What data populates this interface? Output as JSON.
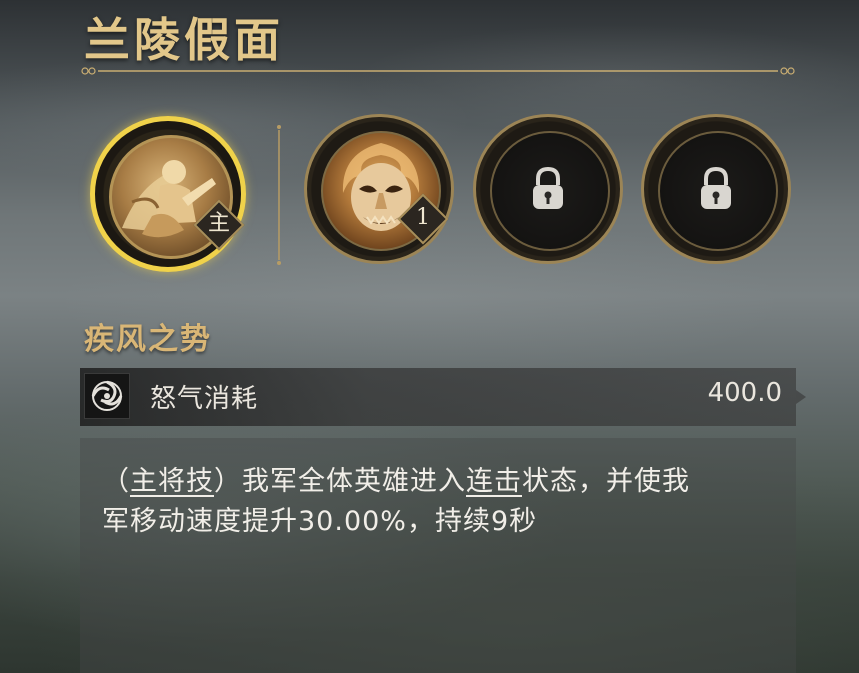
{
  "hero": {
    "title": "兰陵假面"
  },
  "skills": {
    "main": {
      "icon": "hero-warrior-portrait",
      "badge": "主",
      "selected": true
    },
    "second": {
      "icon": "flame-mask-portrait",
      "badge": "1"
    },
    "locked": [
      {
        "icon": "lock-icon"
      },
      {
        "icon": "lock-icon"
      }
    ]
  },
  "skill_detail": {
    "name": "疾风之势",
    "cost_icon": "swirl-icon",
    "cost_label": "怒气消耗",
    "cost_value": "400.0",
    "description": {
      "open_paren": "（",
      "tag": "主将技",
      "close_paren": "）",
      "part1": "我军全体英雄进入",
      "keyword": "连击",
      "part2": "状态，并使我",
      "line2": "军移动速度提升30.00%，持续9秒"
    }
  },
  "colors": {
    "gold": "#e2c78a",
    "gold_selected": "#f0d24a",
    "text_light": "#eae6de"
  }
}
